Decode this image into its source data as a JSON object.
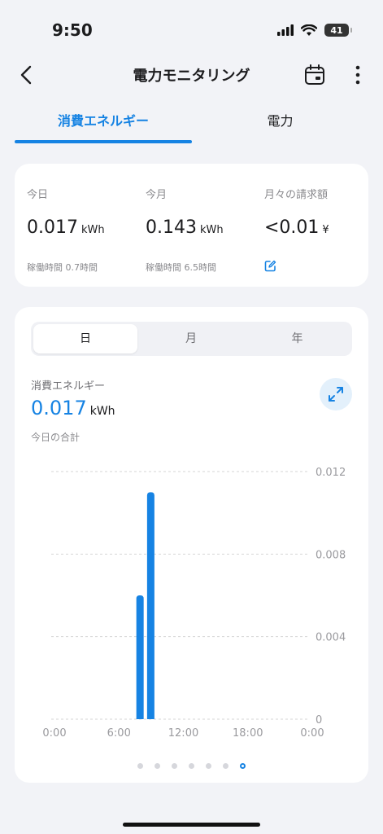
{
  "status_bar": {
    "time": "9:50",
    "battery": "41"
  },
  "header": {
    "title": "電力モニタリング",
    "back_icon": "chevron-left-icon",
    "calendar_icon": "calendar-icon",
    "more_icon": "more-vertical-icon"
  },
  "tabs": [
    {
      "label": "消費エネルギー",
      "active": true
    },
    {
      "label": "電力",
      "active": false
    }
  ],
  "summary": {
    "today": {
      "label": "今日",
      "value": "0.017",
      "unit": "kWh",
      "sub": "稼働時間 0.7時間"
    },
    "month": {
      "label": "今月",
      "value": "0.143",
      "unit": "kWh",
      "sub": "稼働時間 6.5時間"
    },
    "bill": {
      "label": "月々の請求額",
      "value": "<0.01",
      "unit": "¥",
      "edit_icon": "edit-icon"
    }
  },
  "period_tabs": [
    {
      "label": "日",
      "active": true
    },
    {
      "label": "月",
      "active": false
    },
    {
      "label": "年",
      "active": false
    }
  ],
  "metric": {
    "label": "消費エネルギー",
    "value": "0.017",
    "unit": "kWh",
    "sub": "今日の合計",
    "expand_icon": "expand-icon"
  },
  "colors": {
    "accent": "#1683e3",
    "bar": "#1683e3",
    "grid": "#d6d6d6"
  },
  "chart_data": {
    "type": "bar",
    "x_tick_labels": [
      "0:00",
      "6:00",
      "12:00",
      "18:00",
      "0:00"
    ],
    "y_tick_labels": [
      "0.012",
      "0.008",
      "0.004",
      "0"
    ],
    "ylim": [
      0,
      0.012
    ],
    "series": [
      {
        "points": [
          {
            "hour": 8,
            "value": 0.006
          },
          {
            "hour": 9,
            "value": 0.011
          }
        ]
      }
    ],
    "grid": true,
    "y_axis_side": "right"
  },
  "pager": {
    "count": 7,
    "active_index": 6
  }
}
